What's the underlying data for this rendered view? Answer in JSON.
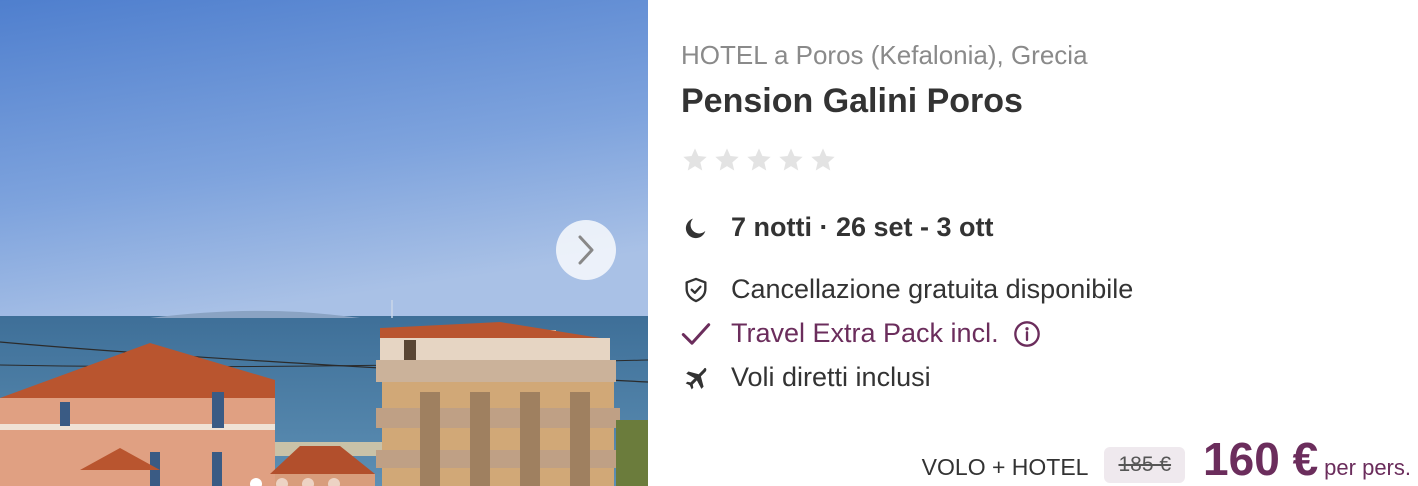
{
  "hotel": {
    "location": "HOTEL a Poros (Kefalonia), Grecia",
    "name": "Pension Galini Poros",
    "stars_filled": 0,
    "stars_total": 5
  },
  "gallery": {
    "slide_count": 4,
    "active_slide": 1
  },
  "stay": {
    "summary": "7 notti · 26 set - 3 ott"
  },
  "features": {
    "cancellation": "Cancellazione gratuita disponibile",
    "extra_pack": "Travel Extra Pack incl.",
    "flights": "Voli diretti inclusi"
  },
  "price": {
    "package_label": "VOLO + HOTEL",
    "old": "185 €",
    "current": "160 €",
    "per_person": "per pers."
  },
  "colors": {
    "accent": "#6b2d5c",
    "muted_text": "#8a8a8a",
    "text": "#333333",
    "star_empty": "#e3e3e3",
    "old_price_bg": "#efe9ee"
  },
  "icons": {
    "nights": "moon-icon",
    "cancellation": "shield-check-icon",
    "extra_pack": "check-icon",
    "extra_info": "info-icon",
    "flights": "plane-icon",
    "gallery_next": "chevron-right-icon"
  }
}
